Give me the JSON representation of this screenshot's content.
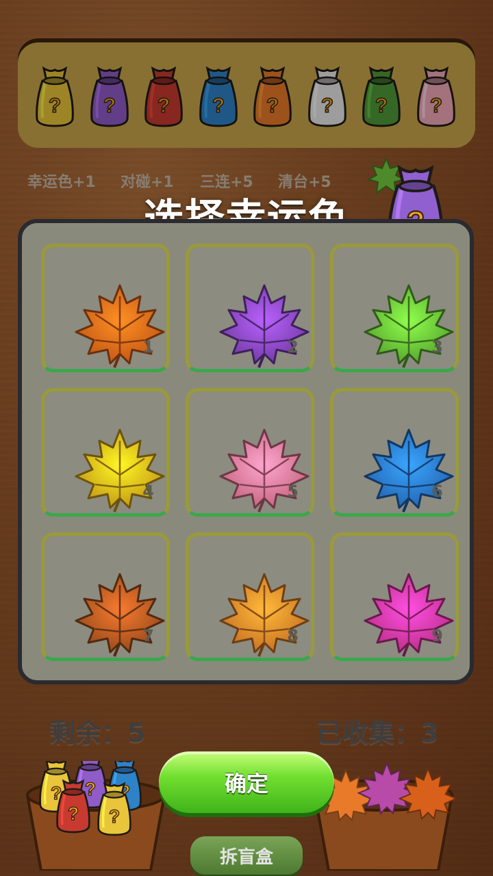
{
  "bags": [
    {
      "color": "#e8c53a",
      "mark": "?"
    },
    {
      "color": "#8f5cc8",
      "mark": "?"
    },
    {
      "color": "#c83a30",
      "mark": "?"
    },
    {
      "color": "#2e82c8",
      "mark": "?"
    },
    {
      "color": "#e87a2a",
      "mark": "?"
    },
    {
      "color": "#e8e8e8",
      "mark": "?"
    },
    {
      "color": "#4f9a38",
      "mark": "?"
    },
    {
      "color": "#f0a8b8",
      "mark": "?"
    }
  ],
  "bonuses": [
    "幸运色+1",
    "对碰+1",
    "三连+5",
    "清台+5"
  ],
  "title": "选择幸运色",
  "big_bag": {
    "color": "#9060d0",
    "mark": "?"
  },
  "leaves": [
    {
      "color": "#f06a1a",
      "num": "1"
    },
    {
      "color": "#8a48c8",
      "num": "2"
    },
    {
      "color": "#6ac838",
      "num": "3"
    },
    {
      "color": "#f0b81a",
      "num": "4"
    },
    {
      "color": "#f27a9a",
      "num": "5"
    },
    {
      "color": "#2a7ad8",
      "num": "6"
    },
    {
      "color": "#b85a22",
      "num": "7"
    },
    {
      "color": "#f58a2a",
      "num": "8"
    },
    {
      "color": "#e83aa8",
      "num": "9"
    }
  ],
  "remaining_label": "剩余：",
  "remaining_value": "5",
  "collected_label": "已收集：",
  "collected_value": "3",
  "confirm_label": "确定",
  "open_box_label": "拆盲盒",
  "pot_bags": [
    "#e8c53a",
    "#8f5cc8",
    "#2e82c8",
    "#c83a30",
    "#e8c53a"
  ],
  "pot_leaves": [
    "#e87a2a",
    "#b84aa8",
    "#d8601a"
  ]
}
